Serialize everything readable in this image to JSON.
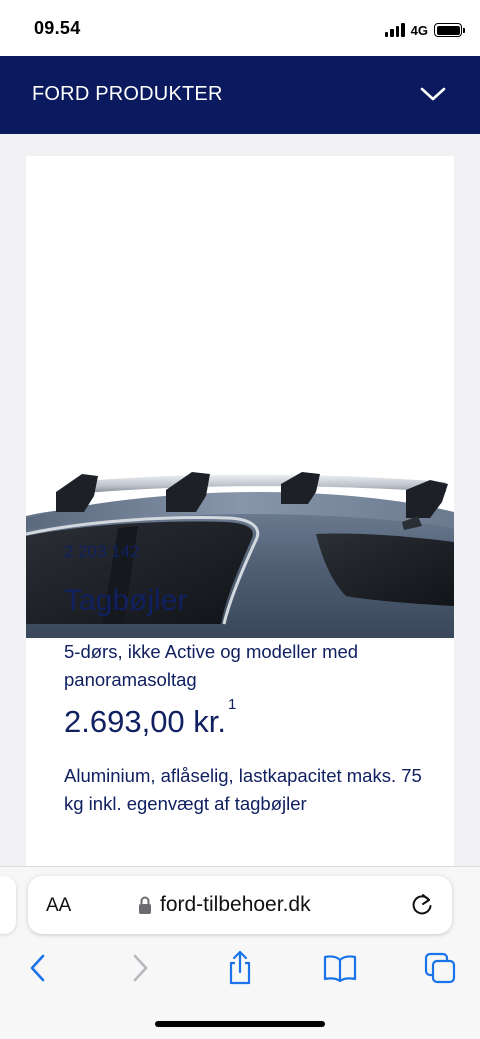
{
  "status_bar": {
    "time": "09.54",
    "network": "4G"
  },
  "header": {
    "title": "FORD PRODUKTER"
  },
  "product": {
    "part_number": "2 203 142",
    "title": "Tagbøjler",
    "subtitle": "5-dørs, ikke Active og modeller med panoramasoltag",
    "price": "2.693,00 kr.",
    "price_footnote": "1",
    "description": "Aluminium, aflåselig, lastkapacitet maks. 75 kg inkl. egenvægt af tagbøjler"
  },
  "browser": {
    "text_size_label": "AA",
    "url": "ford-tilbehoer.dk"
  },
  "colors": {
    "header_bg": "#0b1a5e",
    "text_primary": "#102060",
    "ios_blue": "#1a73e8"
  },
  "icons": [
    "chevron-down-icon",
    "lock-icon",
    "reload-icon",
    "back-icon",
    "forward-icon",
    "share-icon",
    "bookmarks-icon",
    "tabs-icon"
  ]
}
